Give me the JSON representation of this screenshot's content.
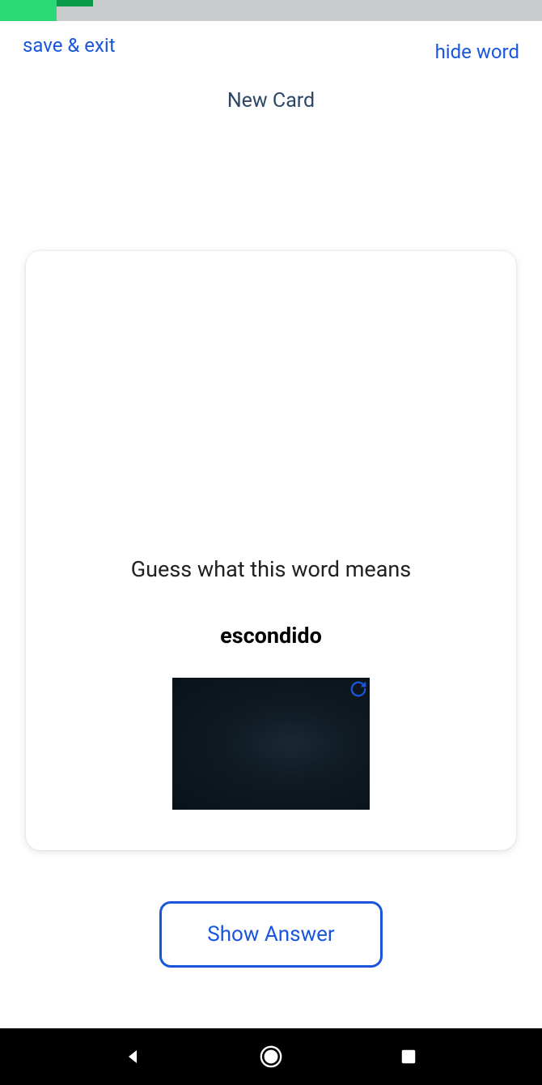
{
  "header": {
    "save_exit": "save & exit",
    "hide_word": "hide word",
    "title": "New Card"
  },
  "card": {
    "prompt": "Guess what this word means",
    "word": "escondido"
  },
  "button": {
    "show_answer": "Show Answer"
  }
}
